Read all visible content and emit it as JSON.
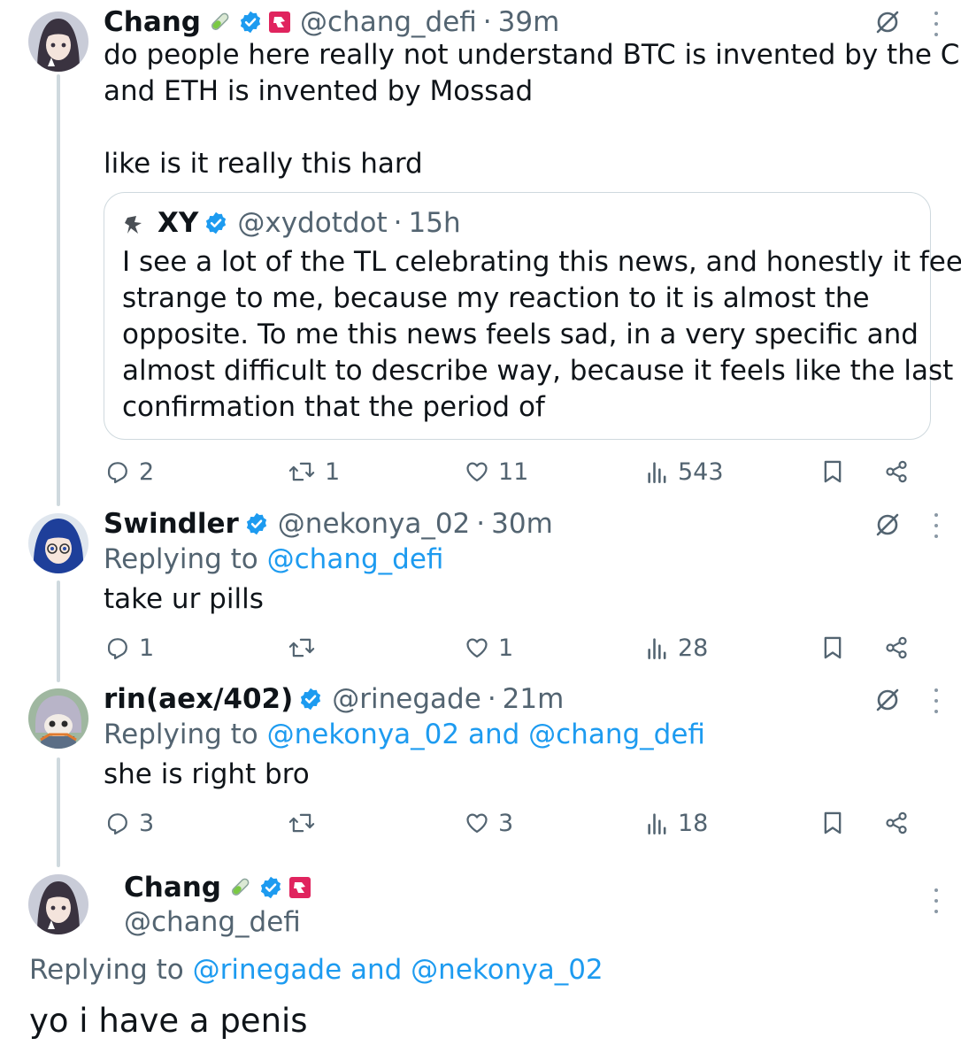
{
  "tweets": [
    {
      "name": "Chang",
      "handle": "@chang_defi",
      "time": "39m",
      "text": "do people here really not understand BTC is invented by the CIA\nand ETH is invented by Mossad\n\nlike is it really this hard",
      "quote": {
        "name": "XY",
        "handle": "@xydotdot",
        "time": "15h",
        "text": "I see a lot of the TL celebrating this news, and honestly it feels\nstrange to me, because my reaction to it is almost the\nopposite. To me this news feels sad, in a very specific and\nalmost difficult to describe way, because it feels like the last\nconfirmation that the period of"
      },
      "replies": "2",
      "reposts": "1",
      "likes": "11",
      "views": "543"
    },
    {
      "name": "Swindler",
      "handle": "@nekonya_02",
      "time": "30m",
      "replying_prefix": "Replying to",
      "replying_to": "@chang_defi",
      "text": "take ur pills",
      "replies": "1",
      "reposts": "",
      "likes": "1",
      "views": "28"
    },
    {
      "name": "rin(aex/402)",
      "handle": "@rinegade",
      "time": "21m",
      "replying_prefix": "Replying to",
      "replying_to": "@nekonya_02 and @chang_defi",
      "text": "she is right bro",
      "replies": "3",
      "reposts": "",
      "likes": "3",
      "views": "18"
    }
  ],
  "main_tweet": {
    "name": "Chang",
    "handle": "@chang_defi",
    "replying_prefix": "Replying to",
    "replying_to": "@rinegade and @nekonya_02",
    "text": "yo i have a penis"
  },
  "separator": "·",
  "colors": {
    "text": "#0f1419",
    "secondary": "#536471",
    "link": "#1d9bf0",
    "verified": "#1d9bf0",
    "border": "#cfd9de"
  },
  "icons": [
    "reply-icon",
    "repost-icon",
    "like-icon",
    "views-icon",
    "bookmark-icon",
    "share-icon",
    "grok-icon",
    "more-icon",
    "verified-badge-icon",
    "test-tube-icon",
    "affiliate-badge-icon"
  ]
}
